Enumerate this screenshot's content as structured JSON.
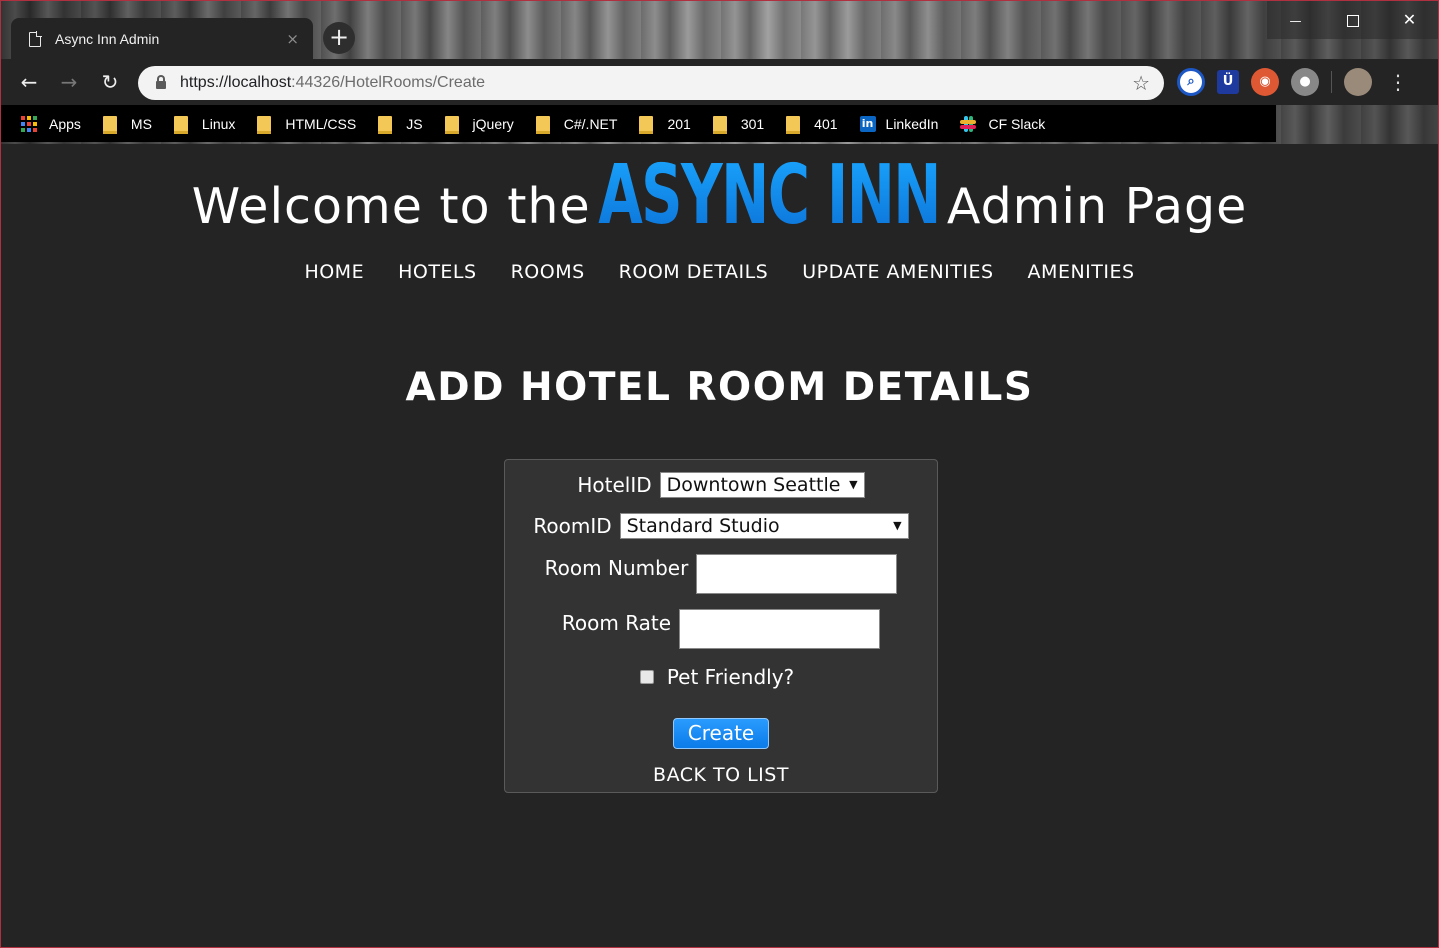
{
  "browser": {
    "tab_title": "Async Inn Admin",
    "tab_close": "×",
    "new_tab": "+",
    "window_controls": {
      "minimize": "—",
      "close": "✕"
    },
    "nav": {
      "back": "←",
      "forward": "→",
      "reload": "↻"
    },
    "url_host": "https://localhost",
    "url_path": ":44326/HotelRooms/Create",
    "star": "☆",
    "menu": "⋮",
    "bookmarks": [
      {
        "label": "Apps",
        "icon": "apps-grid-icon"
      },
      {
        "label": "MS",
        "icon": "folder-icon"
      },
      {
        "label": "Linux",
        "icon": "folder-icon"
      },
      {
        "label": "HTML/CSS",
        "icon": "folder-icon"
      },
      {
        "label": "JS",
        "icon": "folder-icon"
      },
      {
        "label": "jQuery",
        "icon": "folder-icon"
      },
      {
        "label": "C#/.NET",
        "icon": "folder-icon"
      },
      {
        "label": "201",
        "icon": "folder-icon"
      },
      {
        "label": "301",
        "icon": "folder-icon"
      },
      {
        "label": "401",
        "icon": "folder-icon"
      },
      {
        "label": "LinkedIn",
        "icon": "linkedin-icon"
      },
      {
        "label": "CF Slack",
        "icon": "slack-icon"
      }
    ]
  },
  "header": {
    "welcome": "Welcome to the",
    "brand": "ASYNC INN",
    "suffix": "Admin Page"
  },
  "nav": [
    "HOME",
    "HOTELS",
    "ROOMS",
    "ROOM DETAILS",
    "UPDATE AMENITIES",
    "AMENITIES"
  ],
  "page_title": "ADD HOTEL ROOM DETAILS",
  "form": {
    "hotel_label": "HotelID",
    "hotel_value": "Downtown Seattle",
    "room_label": "RoomID",
    "room_value": "Standard Studio",
    "room_number_label": "Room Number",
    "room_number_value": "",
    "room_rate_label": "Room Rate",
    "room_rate_value": "",
    "pet_label": "Pet Friendly?",
    "pet_checked": false,
    "submit": "Create",
    "back": "BACK TO LIST"
  },
  "colors": {
    "page_bg": "#242424",
    "brand": "#1a8eff",
    "button": "#0a7be8",
    "form_bg": "#333333"
  }
}
